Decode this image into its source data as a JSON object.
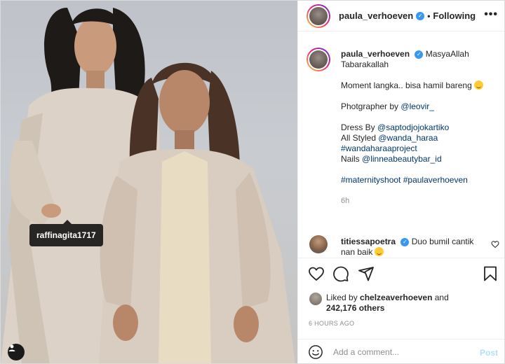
{
  "post": {
    "photo_tag": "raffinagita1717",
    "icons": {
      "user_tag": "person-icon"
    }
  },
  "header": {
    "username": "paula_verhoeven",
    "verified_icon": "verified-badge-icon",
    "separator": "•",
    "follow_status": "Following",
    "more_icon": "more-options-icon"
  },
  "caption": {
    "username": "paula_verhoeven",
    "lines": [
      "MasyaAllah Tabarakallah",
      "Moment langka.. bisa hamil bareng",
      "Photgrapher by ",
      "@leovir_",
      "Dress By ",
      "@saptodjojokartiko",
      "All Styled ",
      "@wanda_haraa",
      "#wandaharaaproject",
      "Nails ",
      "@linneabeautybar_id",
      "#maternityshoot",
      "#paulaverhoeven"
    ],
    "time": "6h"
  },
  "comment": {
    "username": "titiessapoetra",
    "text": "Duo bumil cantik nan baik"
  },
  "actions": {
    "like_icon": "heart-icon",
    "comment_icon": "comment-icon",
    "share_icon": "share-icon",
    "save_icon": "bookmark-icon"
  },
  "likes": {
    "prefix": "Liked by ",
    "user": "chelzeaverhoeven",
    "middle": " and",
    "count": "242,176 others"
  },
  "posted_ago": "6 HOURS AGO",
  "composer": {
    "placeholder": "Add a comment...",
    "post_label": "Post",
    "emoji_icon": "smiley-icon"
  },
  "colors": {
    "verified": "#3897f0",
    "link": "#00376b",
    "post_disabled": "#b2dffc",
    "muted": "#8e8e8e"
  }
}
